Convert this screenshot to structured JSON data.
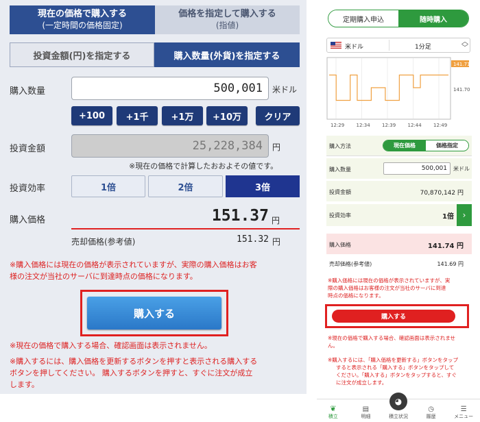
{
  "left": {
    "top_tabs": [
      {
        "line1": "現在の価格で購入する",
        "line2": "(一定時間の価格固定)"
      },
      {
        "line1": "価格を指定して購入する",
        "line2": "(指値)"
      }
    ],
    "second_tabs": [
      "投資金額(円)を指定する",
      "購入数量(外貨)を指定する"
    ],
    "quantity_label": "購入数量",
    "quantity_value": "500,001",
    "quantity_unit": "米ドル",
    "quick_buttons": [
      "+100",
      "+1千",
      "+1万",
      "+10万",
      "クリア"
    ],
    "amount_label": "投資金額",
    "amount_value": "25,228,384",
    "amount_unit": "円",
    "amount_note": "※現在の価格で計算したおおよその値です。",
    "efficiency_label": "投資効率",
    "efficiency_options": [
      "1倍",
      "2倍",
      "3倍"
    ],
    "price_label": "購入価格",
    "price_value": "151.37",
    "price_unit": "円",
    "sell_label": "売却価格(参考値)",
    "sell_value": "151.32",
    "sell_unit": "円",
    "note1_l1": "※購入価格には現在の価格が表示されていますが、実際の購入価格はお客",
    "note1_l2": "様の注文が当社のサーバに到達時点の価格になります。",
    "buy_label": "購入する",
    "note2": "※現在の価格で購入する場合、確認画面は表示されません。",
    "note3_l1": "※購入するには、購入価格を更新するボタンを押すと表示される購入する",
    "note3_l2": "ボタンを押してください。 購入するボタンを押すと、すぐに注文が成立",
    "note3_l3": "します。"
  },
  "right": {
    "mode_tabs": [
      "定期購入申込",
      "随時購入"
    ],
    "currency": "米ドル",
    "interval": "1分足",
    "chart_price_high": "141.71",
    "chart_price_mid": "141.70",
    "method_label": "購入方法",
    "method_options": [
      "現在価格",
      "価格指定"
    ],
    "quantity_label": "購入数量",
    "quantity_value": "500,001",
    "quantity_unit": "米ドル",
    "amount_label": "投資金額",
    "amount_value": "70,870,142 円",
    "efficiency_label": "投資効率",
    "efficiency_value": "1倍",
    "price_label": "購入価格",
    "price_value": "141.74 円",
    "sell_label": "売却価格(参考値)",
    "sell_value": "141.69 円",
    "note1_l1": "※購入価格には現在の価格が表示されていますが、実",
    "note1_l2": "際の購入価格はお客様の注文が当社のサーバに到達",
    "note1_l3": "時点の価格になります。",
    "buy_label": "購入する",
    "note2_l1": "※現在の価格で購入する場合、確認画面は表示されませ",
    "note2_l2": "ん。",
    "note3_l1": "※購入するには、「購入価格を更新する」ボタンをタップ",
    "note3_l2": "すると表示される「購入する」ボタンをタップして",
    "note3_l3": "ください。「購入する」ボタンをタップすると、すぐ",
    "note3_l4": "に注文が成立します。",
    "nav": [
      "積立",
      "明細",
      "積立状況",
      "履歴",
      "メニュー"
    ]
  },
  "chart_data": {
    "type": "line",
    "x": [
      "12:29",
      "12:34",
      "12:39",
      "12:44",
      "12:49"
    ],
    "series": [
      {
        "values": [
          141.71,
          141.7,
          141.7,
          141.71,
          141.7,
          141.7,
          141.705,
          141.705,
          141.7,
          141.7,
          141.71,
          141.71,
          141.705,
          141.71,
          141.71,
          141.71,
          141.71,
          141.71
        ]
      }
    ],
    "ylabels": [
      "141.71",
      "141.70"
    ],
    "color": "#f0a040"
  },
  "colors": {
    "navy": "#1f3a78",
    "red": "#e02020",
    "green": "#2e9a3e",
    "buy_blue": "#2a7fd0"
  }
}
